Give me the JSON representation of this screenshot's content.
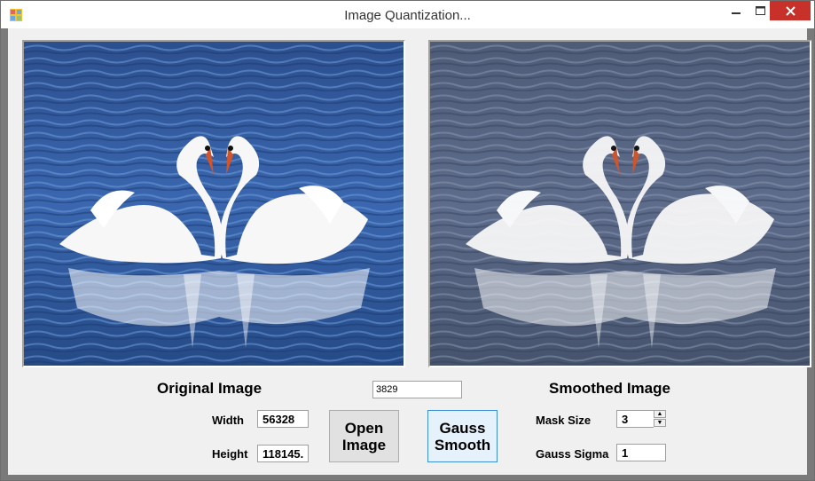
{
  "window": {
    "title": "Image Quantization...",
    "close_color": "#c7312a"
  },
  "icons": {
    "app": "app-icon",
    "minimize": "minimize-icon",
    "maximize": "maximize-icon",
    "close": "close-icon"
  },
  "original": {
    "label": "Original Image",
    "width_label": "Width",
    "width_value": "56328",
    "height_label": "Height",
    "height_value": "118145."
  },
  "time_box": "3829",
  "buttons": {
    "open_line1": "Open",
    "open_line2": "Image",
    "gauss_line1": "Gauss",
    "gauss_line2": "Smooth"
  },
  "smoothed": {
    "label": "Smoothed Image",
    "mask_label": "Mask Size",
    "mask_value": "3",
    "sigma_label": "Gauss Sigma",
    "sigma_value": "1"
  }
}
